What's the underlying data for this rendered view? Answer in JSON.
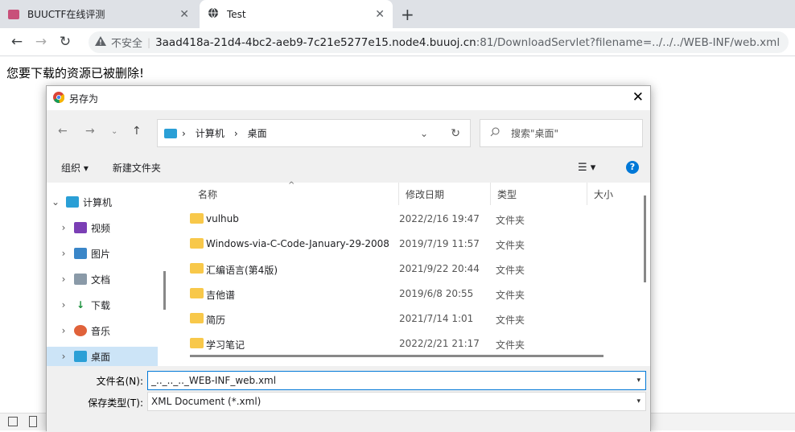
{
  "browser": {
    "tabs": [
      {
        "title": "BUUCTF在线评测",
        "close": "✕"
      },
      {
        "title": "Test",
        "close": "✕"
      }
    ],
    "new_tab": "+",
    "nav": {
      "back": "←",
      "forward": "→",
      "reload": "↻"
    },
    "address": {
      "security": "不安全",
      "host": "3aad418a-21d4-4bc2-aeb9-7c21e5277e15.node4.buuoj.cn",
      "rest": ":81/DownloadServlet?filename=../../../WEB-INF/web.xml"
    }
  },
  "page": {
    "message": "您要下载的资源已被删除!"
  },
  "dialog": {
    "title": "另存为",
    "close": "✕",
    "breadcrumb": [
      "计算机",
      "桌面"
    ],
    "search_placeholder": "搜索\"桌面\"",
    "toolbar": {
      "organize": "组织 ▾",
      "new_folder": "新建文件夹",
      "help": "?"
    },
    "sidebar": [
      {
        "label": "计算机"
      },
      {
        "label": "视频"
      },
      {
        "label": "图片"
      },
      {
        "label": "文档"
      },
      {
        "label": "下载"
      },
      {
        "label": "音乐"
      },
      {
        "label": "桌面"
      }
    ],
    "columns": [
      "名称",
      "修改日期",
      "类型",
      "大小"
    ],
    "files": [
      {
        "name": "vulhub",
        "date": "2022/2/16 19:47",
        "type": "文件夹"
      },
      {
        "name": "Windows-via-C-Code-January-29-2008",
        "date": "2019/7/19 11:57",
        "type": "文件夹"
      },
      {
        "name": "汇编语言(第4版)",
        "date": "2021/9/22 20:44",
        "type": "文件夹"
      },
      {
        "name": "吉他谱",
        "date": "2019/6/8 20:55",
        "type": "文件夹"
      },
      {
        "name": "简历",
        "date": "2021/7/14 1:01",
        "type": "文件夹"
      },
      {
        "name": "学习笔记",
        "date": "2022/2/21 21:17",
        "type": "文件夹"
      }
    ],
    "filename_label": "文件名(N):",
    "filename_value": "_.._.._.._WEB-INF_web.xml",
    "filetype_label": "保存类型(T):",
    "filetype_value": "XML Document (*.xml)"
  },
  "colors": {
    "accent": "#0078d7",
    "folder": "#f8c84a"
  }
}
